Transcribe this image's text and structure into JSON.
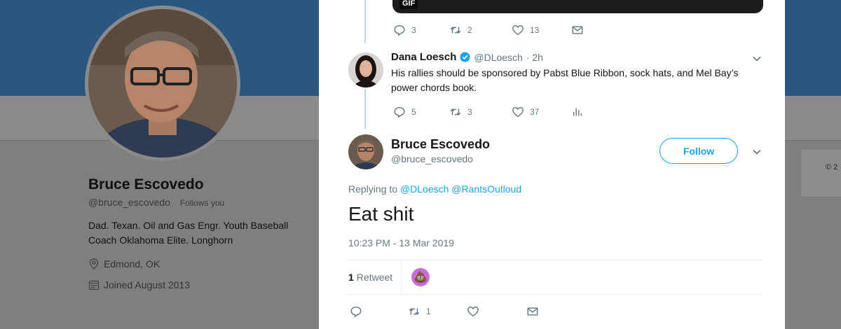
{
  "profile": {
    "name": "Bruce Escovedo",
    "handle": "@bruce_escovedo",
    "follows_you": "Follows you",
    "bio": "Dad. Texan. Oil and Gas Engr. Youth Baseball Coach Oklahoma Elite. Longhorn",
    "location": "Edmond, OK",
    "joined": "Joined August 2013",
    "side_text": "© 2"
  },
  "gif_tweet": {
    "gif_label": "GIF",
    "replies": "3",
    "retweets": "2",
    "likes": "13"
  },
  "reply_tweet": {
    "name": "Dana Loesch",
    "handle": "@DLoesch",
    "time": "· 2h",
    "text": "His rallies should be sponsored by Pabst Blue Ribbon, sock hats, and Mel Bay’s power chords book.",
    "replies": "5",
    "retweets": "3",
    "likes": "37"
  },
  "main_tweet": {
    "name": "Bruce Escovedo",
    "handle": "@bruce_escovedo",
    "follow_label": "Follow",
    "replying_prefix": "Replying to",
    "replying_to_1": "@DLoesch",
    "replying_to_2": "@RantsOutloud",
    "text": "Eat shit",
    "timestamp": "10:23 PM - 13 Mar 2019",
    "retweet_count": "1",
    "retweet_label": "Retweet",
    "retweets": "1"
  },
  "colors": {
    "accent": "#1da1f2",
    "muted": "#657786",
    "banner": "#2a5680"
  }
}
